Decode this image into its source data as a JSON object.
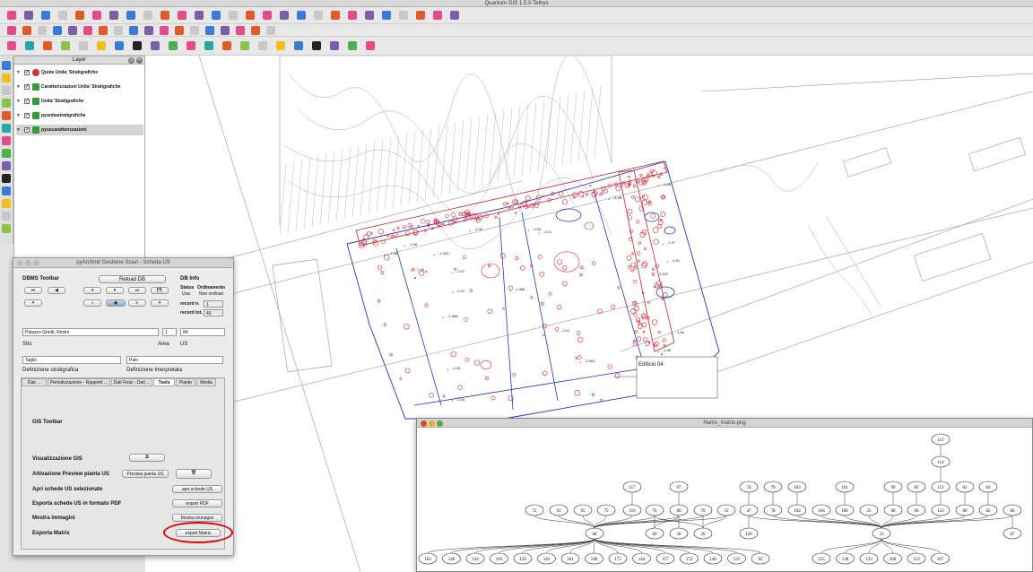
{
  "app": {
    "title": "Quantum GIS 1.5.0-Tethys"
  },
  "layers_panel": {
    "title": "Layer",
    "items": [
      {
        "label": "Quote Unita' Stratigrafiche",
        "selected": false
      },
      {
        "label": "Caratterizzazioni Unita' Stratigrafiche",
        "selected": false
      },
      {
        "label": "Unita' Stratigrafiche",
        "selected": false
      },
      {
        "label": "pyunitastratigrafiche",
        "selected": false
      },
      {
        "label": "pyuscaratterizzazioni",
        "selected": true
      }
    ]
  },
  "map": {
    "callout": "Edificio 04",
    "labels": [
      "-1.98",
      "-2.02",
      "-1.94",
      "-1.063",
      "-2.01",
      "-2.05",
      "-1.85",
      "-2.01",
      "-1.966",
      "-2.01",
      "-1.968",
      "-2.01",
      "-1.97",
      "-1.963",
      "-2.05",
      "-2.05",
      "-1.81",
      "-1.937",
      "-1.82",
      "-1.98",
      "-1.85",
      "-1.90"
    ]
  },
  "pyarchinit": {
    "title": "pyArchInit Gestione Scavi - Scheda US",
    "dbms_toolbar": "DBMS Toolbar",
    "reload_db": "Reload DB",
    "db_info": "DB Info",
    "status_label": "Status",
    "status_value": "Usa",
    "ordinamento_label": "Ordinamento",
    "ordinamento_value": "Non ordinati",
    "record_n_label": "record n.",
    "record_n_value": "1",
    "record_tot_label": "record tot.",
    "record_tot_value": "40",
    "sito_value": "Palazzo Ghetti, Rimini",
    "area_value": "1",
    "us_value": "84",
    "sito_label": "Sito",
    "area_label": "Area",
    "us_label": "US",
    "def_strat_value": "Taglio",
    "def_interp_value": "Palo",
    "def_strat_label": "Definizione stratigrafica",
    "def_interp_label": "Definizione Interpretata",
    "tabs": [
      "Dati ...",
      "Periodizzazione - Rapporti ...",
      "Dati Fisici - Dati ...",
      "Tools",
      "Piante",
      "Media"
    ],
    "active_tab": "Tools",
    "gis_toolbar": "GIS Toolbar",
    "vis_gis": "Visualizzazione GIS",
    "preview_label": "Attivazione Preview pianta US",
    "preview_btn": "Preview pianta US",
    "apri_label": "Apri schede US selezionate",
    "apri_btn": "apri schede US",
    "esporta_pdf_label": "Esporta schede US in formato PDF",
    "esporta_pdf_btn": "export PDF",
    "mostra_label": "Mostra immagini",
    "mostra_btn": "Mostra immagini",
    "matrix_label": "Esporta Matrix",
    "matrix_btn": "export Matrix",
    "highlight_color": "#e00000"
  },
  "harris": {
    "title": "Harris_matrix.png",
    "nodes": [
      "115",
      "114",
      "113",
      "117",
      "67",
      "74",
      "79",
      "103",
      "101",
      "99",
      "85",
      "81",
      "83",
      "72",
      "93",
      "95",
      "75",
      "116",
      "76",
      "66",
      "70",
      "53",
      "47",
      "78",
      "102",
      "104",
      "100",
      "25",
      "98",
      "84",
      "112",
      "80",
      "82",
      "86",
      "69",
      "30",
      "26",
      "120",
      "68",
      "31",
      "87",
      "163",
      "146",
      "134",
      "165",
      "159",
      "142",
      "181",
      "140",
      "175",
      "144",
      "157",
      "172",
      "148",
      "121",
      "92",
      "155",
      "138",
      "133",
      "160",
      "153",
      "167"
    ]
  }
}
